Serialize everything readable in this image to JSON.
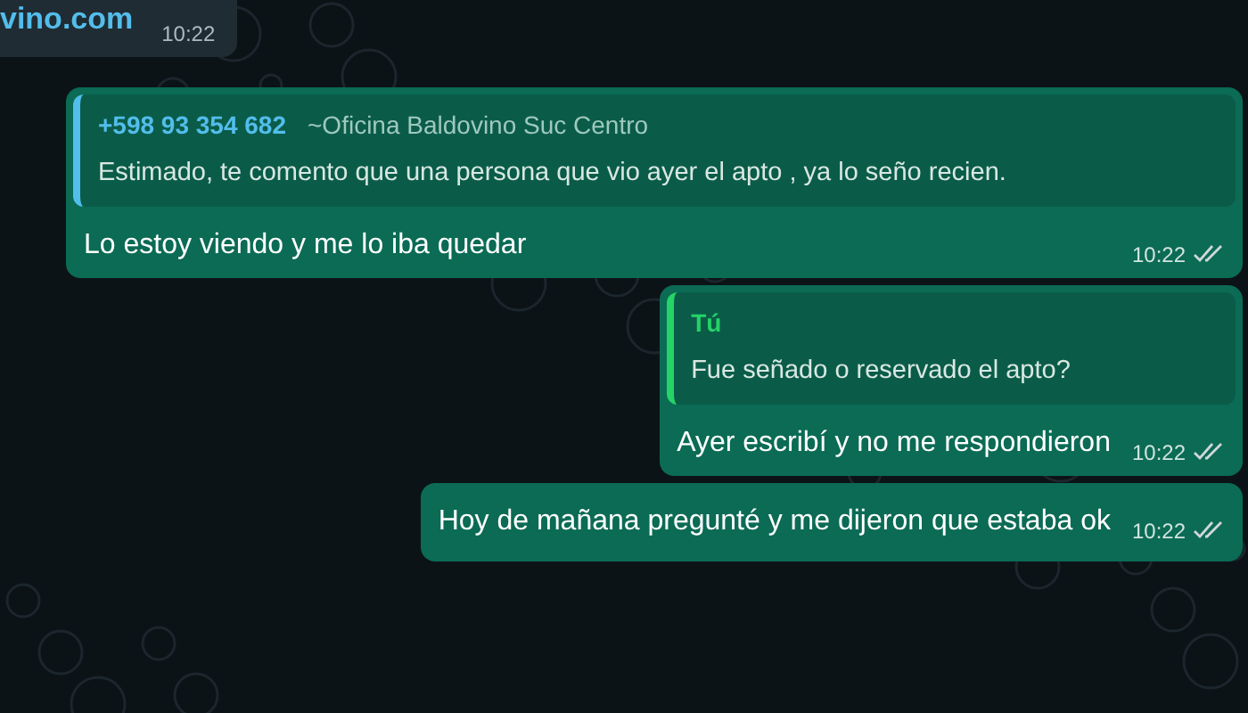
{
  "top_message": {
    "text": "vino.com",
    "time": "10:22"
  },
  "messages": [
    {
      "kind": "reply",
      "quote": {
        "author": "+598 93 354 682",
        "author_note": "~Oficina Baldovino Suc Centro",
        "text": "Estimado, te comento que una persona que vio ayer el apto , ya lo seño recien."
      },
      "text": "Lo estoy viendo y me lo iba quedar",
      "time": "10:22",
      "read": true
    },
    {
      "kind": "reply",
      "quote": {
        "author": "Tú",
        "text": "Fue señado o reservado el apto?"
      },
      "text": "Ayer escribí y no me respondieron",
      "time": "10:22",
      "read": true
    },
    {
      "kind": "plain",
      "text": "Hoy de mañana pregunté y me dijeron que estaba ok",
      "time": "10:22",
      "read": true
    }
  ]
}
